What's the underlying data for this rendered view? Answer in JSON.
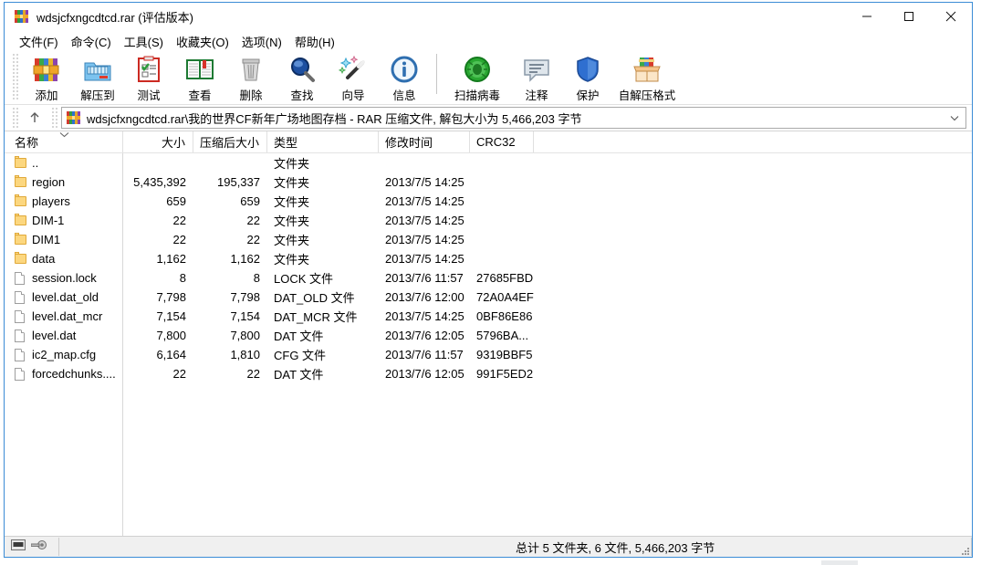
{
  "window": {
    "title": "wdsjcfxngcdtcd.rar (评估版本)",
    "icon": "winrar-books-icon",
    "controls": {
      "minimize": "minimize-icon",
      "maximize": "maximize-icon",
      "close": "close-icon"
    }
  },
  "menu": {
    "items": [
      {
        "label": "文件(F)",
        "name": "menu-file"
      },
      {
        "label": "命令(C)",
        "name": "menu-commands"
      },
      {
        "label": "工具(S)",
        "name": "menu-tools"
      },
      {
        "label": "收藏夹(O)",
        "name": "menu-favorites"
      },
      {
        "label": "选项(N)",
        "name": "menu-options"
      },
      {
        "label": "帮助(H)",
        "name": "menu-help"
      }
    ]
  },
  "toolbar": {
    "buttons": [
      {
        "label": "添加",
        "icon": "add-archive-icon",
        "name": "toolbar-add"
      },
      {
        "label": "解压到",
        "icon": "extract-to-icon",
        "name": "toolbar-extract-to"
      },
      {
        "label": "测试",
        "icon": "test-clipboard-icon",
        "name": "toolbar-test"
      },
      {
        "label": "查看",
        "icon": "view-book-icon",
        "name": "toolbar-view"
      },
      {
        "label": "删除",
        "icon": "delete-trash-icon",
        "name": "toolbar-delete"
      },
      {
        "label": "查找",
        "icon": "find-magnifier-icon",
        "name": "toolbar-find"
      },
      {
        "label": "向导",
        "icon": "wizard-wand-icon",
        "name": "toolbar-wizard"
      },
      {
        "label": "信息",
        "icon": "info-circle-icon",
        "name": "toolbar-info"
      },
      {
        "label": "扫描病毒",
        "icon": "virus-scan-icon",
        "name": "toolbar-virus-scan"
      },
      {
        "label": "注释",
        "icon": "comment-icon",
        "name": "toolbar-comment"
      },
      {
        "label": "保护",
        "icon": "shield-icon",
        "name": "toolbar-protect"
      },
      {
        "label": "自解压格式",
        "icon": "sfx-box-icon",
        "name": "toolbar-sfx"
      }
    ]
  },
  "address": {
    "up_icon": "arrow-up-icon",
    "archive_icon": "winrar-books-icon",
    "path": "wdsjcfxngcdtcd.rar\\我的世界CF新年广场地图存档 - RAR 压缩文件, 解包大小为 5,466,203 字节",
    "dropdown_icon": "chevron-down-icon"
  },
  "list": {
    "columns": [
      {
        "label": "名称",
        "name": "column-name",
        "align": "left"
      },
      {
        "label": "大小",
        "name": "column-size",
        "align": "right"
      },
      {
        "label": "压缩后大小",
        "name": "column-packed",
        "align": "right"
      },
      {
        "label": "类型",
        "name": "column-type",
        "align": "left"
      },
      {
        "label": "修改时间",
        "name": "column-modified",
        "align": "left"
      },
      {
        "label": "CRC32",
        "name": "column-crc32",
        "align": "left"
      }
    ],
    "sort_indicator": "chevron-down-icon",
    "rows": [
      {
        "icon": "folder-icon",
        "name": "..",
        "size": "",
        "packed": "",
        "type": "文件夹",
        "modified": "",
        "crc32": ""
      },
      {
        "icon": "folder-icon",
        "name": "region",
        "size": "5,435,392",
        "packed": "195,337",
        "type": "文件夹",
        "modified": "2013/7/5 14:25",
        "crc32": ""
      },
      {
        "icon": "folder-icon",
        "name": "players",
        "size": "659",
        "packed": "659",
        "type": "文件夹",
        "modified": "2013/7/5 14:25",
        "crc32": ""
      },
      {
        "icon": "folder-icon",
        "name": "DIM-1",
        "size": "22",
        "packed": "22",
        "type": "文件夹",
        "modified": "2013/7/5 14:25",
        "crc32": ""
      },
      {
        "icon": "folder-icon",
        "name": "DIM1",
        "size": "22",
        "packed": "22",
        "type": "文件夹",
        "modified": "2013/7/5 14:25",
        "crc32": ""
      },
      {
        "icon": "folder-icon",
        "name": "data",
        "size": "1,162",
        "packed": "1,162",
        "type": "文件夹",
        "modified": "2013/7/5 14:25",
        "crc32": ""
      },
      {
        "icon": "file-icon",
        "name": "session.lock",
        "size": "8",
        "packed": "8",
        "type": "LOCK 文件",
        "modified": "2013/7/6 11:57",
        "crc32": "27685FBD"
      },
      {
        "icon": "file-icon",
        "name": "level.dat_old",
        "size": "7,798",
        "packed": "7,798",
        "type": "DAT_OLD 文件",
        "modified": "2013/7/6 12:00",
        "crc32": "72A0A4EF"
      },
      {
        "icon": "file-icon",
        "name": "level.dat_mcr",
        "size": "7,154",
        "packed": "7,154",
        "type": "DAT_MCR 文件",
        "modified": "2013/7/5 14:25",
        "crc32": "0BF86E86"
      },
      {
        "icon": "file-icon",
        "name": "level.dat",
        "size": "7,800",
        "packed": "7,800",
        "type": "DAT 文件",
        "modified": "2013/7/6 12:05",
        "crc32": "5796BA..."
      },
      {
        "icon": "file-icon",
        "name": "ic2_map.cfg",
        "size": "6,164",
        "packed": "1,810",
        "type": "CFG 文件",
        "modified": "2013/7/6 11:57",
        "crc32": "9319BBF5"
      },
      {
        "icon": "file-icon",
        "name": "forcedchunks....",
        "size": "22",
        "packed": "22",
        "type": "DAT 文件",
        "modified": "2013/7/6 12:05",
        "crc32": "991F5ED2"
      }
    ]
  },
  "statusbar": {
    "drive_icon": "drive-icon",
    "key_icon": "key-icon",
    "summary": "总计 5 文件夹, 6 文件, 5,466,203 字节",
    "resize_grip": "resize-grip-icon"
  },
  "colors": {
    "window_border": "#3b8cd6",
    "folder": "#fcd77f",
    "status_bg": "#f0f0f0"
  }
}
